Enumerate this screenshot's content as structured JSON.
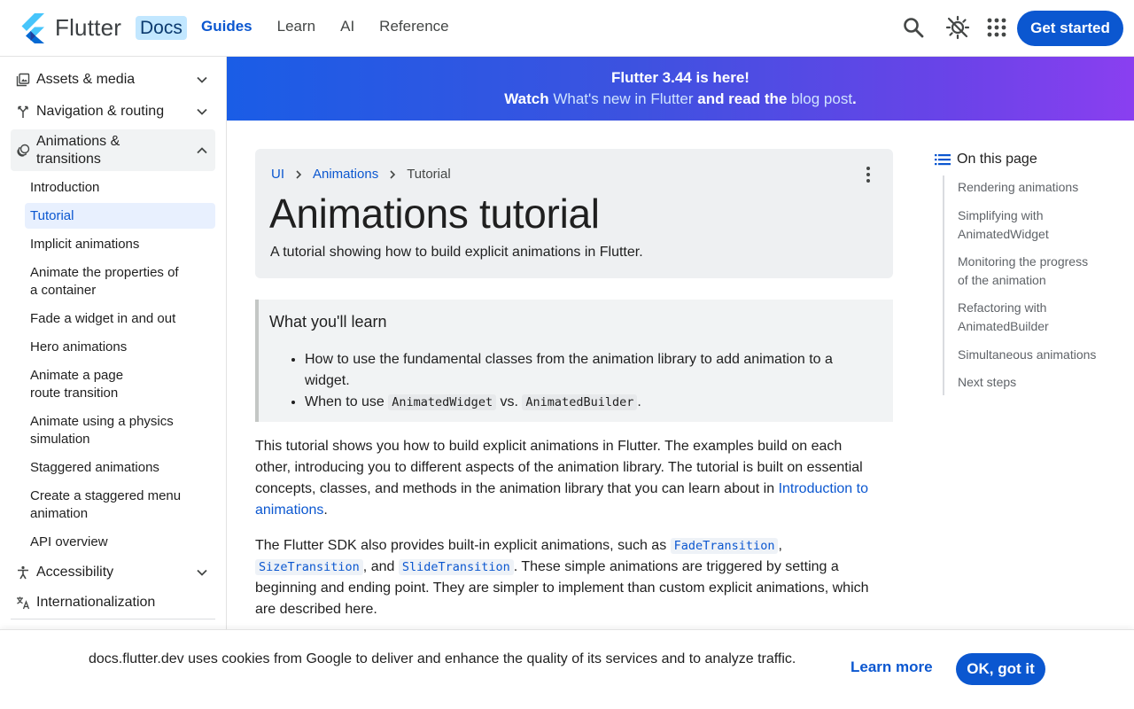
{
  "header": {
    "brand": "Flutter",
    "badge": "Docs",
    "nav": [
      {
        "label": "Guides",
        "active": true
      },
      {
        "label": "Learn"
      },
      {
        "label": "AI"
      },
      {
        "label": "Reference"
      }
    ],
    "icons": [
      "search-icon",
      "theme-toggle-icon",
      "apps-grid-icon"
    ],
    "cta": "Get started"
  },
  "sidebar": {
    "sections_top": [
      {
        "label": "Assets & media",
        "icon": "photo-library-icon"
      },
      {
        "label": "Navigation & routing",
        "icon": "fork-icon"
      }
    ],
    "open_section": {
      "line1": "Animations &",
      "line2": "transitions",
      "icon": "animation-icon"
    },
    "items": [
      {
        "l1": "Introduction"
      },
      {
        "l1": "Tutorial",
        "active": true
      },
      {
        "l1": "Implicit animations"
      },
      {
        "l1": "Animate the properties of",
        "l2": "a container"
      },
      {
        "l1": "Fade a widget in and out"
      },
      {
        "l1": "Hero animations"
      },
      {
        "l1": "Animate a page",
        "l2": "route transition"
      },
      {
        "l1": "Animate using a physics",
        "l2": "simulation"
      },
      {
        "l1": "Staggered animations"
      },
      {
        "l1": "Create a staggered menu",
        "l2": "animation"
      },
      {
        "l1": "API overview"
      }
    ],
    "sections_bottom": [
      {
        "label": "Accessibility",
        "icon": "accessibility-icon"
      },
      {
        "label": "Internationalization",
        "icon": "translate-icon"
      }
    ]
  },
  "banner": {
    "line1": "Flutter 3.44 is here!",
    "pre": "Watch ",
    "link1": "What's new in Flutter",
    "mid": " and read the ",
    "link2": "blog post",
    "post": "."
  },
  "breadcrumb": {
    "items": [
      "UI",
      "Animations"
    ],
    "current": "Tutorial"
  },
  "page": {
    "title": "Animations tutorial",
    "subtitle": "A tutorial showing how to build explicit animations in Flutter."
  },
  "learn": {
    "title": "What you'll learn",
    "b1": "How to use the fundamental classes from the animation library to add animation to a widget.",
    "b2_pre": "When to use ",
    "b2_code1": "AnimatedWidget",
    "b2_mid": " vs. ",
    "b2_code2": "AnimatedBuilder",
    "b2_post": "."
  },
  "body": {
    "p1": "This tutorial shows you how to build explicit animations in Flutter. The examples build on each other, introducing you to different aspects of the animation library. The tutorial is built on essential concepts, classes, and methods in the animation library that you can learn about in ",
    "p1_link": "Introduction to animations",
    "p1_end": ".",
    "p2_pre": "The Flutter SDK also provides built-in explicit animations, such as ",
    "p2_c1": "FadeTransition",
    "p2_s1": ",",
    "p2_c2": "SizeTransition",
    "p2_s2": ", and ",
    "p2_c3": "SlideTransition",
    "p2_post": ". These simple animations are triggered by setting a beginning and ending point. They are simpler to implement than custom explicit animations, which are described here."
  },
  "toc": {
    "title": "On this page",
    "items": [
      {
        "l1": "Rendering animations"
      },
      {
        "l1": "Simplifying with",
        "l2": "AnimatedWidget"
      },
      {
        "l1": "Monitoring the progress",
        "l2": "of the animation"
      },
      {
        "l1": "Refactoring with",
        "l2": "AnimatedBuilder"
      },
      {
        "l1": "Simultaneous animations"
      },
      {
        "l1": "Next steps"
      }
    ]
  },
  "cookie": {
    "text": "docs.flutter.dev uses cookies from Google to deliver and enhance the quality of its services and to analyze traffic.",
    "learn_more": "Learn more",
    "ok": "OK, got it"
  },
  "colors": {
    "accent": "#0b57d0",
    "banner_start": "#1a5de6",
    "banner_end": "#8a3ff0"
  }
}
